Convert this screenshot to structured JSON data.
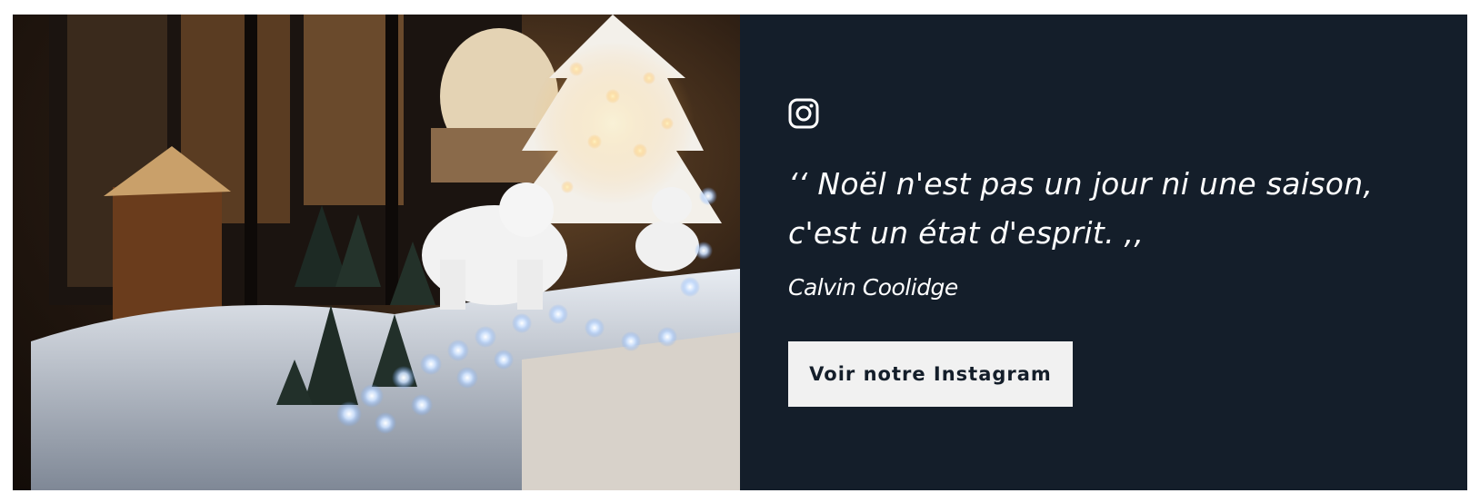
{
  "banner": {
    "photo_alt": "Vitrine de Noël avec ours polaires, sapin blanc et guirlandes lumineuses",
    "social_icon": "instagram-icon",
    "quote": "‘‘ Noël n'est pas un jour ni une saison, c'est un état d'esprit. ,,",
    "quote_line1": "‘‘ Noël n'est pas un jour ni une saison,",
    "quote_line2": "c'est un état d'esprit. ,,",
    "author": "Calvin Coolidge",
    "cta_label": "Voir notre Instagram"
  },
  "colors": {
    "panel_bg": "#141e2a",
    "text": "#ffffff",
    "button_bg": "#f1f1f1",
    "button_text": "#141e2a"
  }
}
